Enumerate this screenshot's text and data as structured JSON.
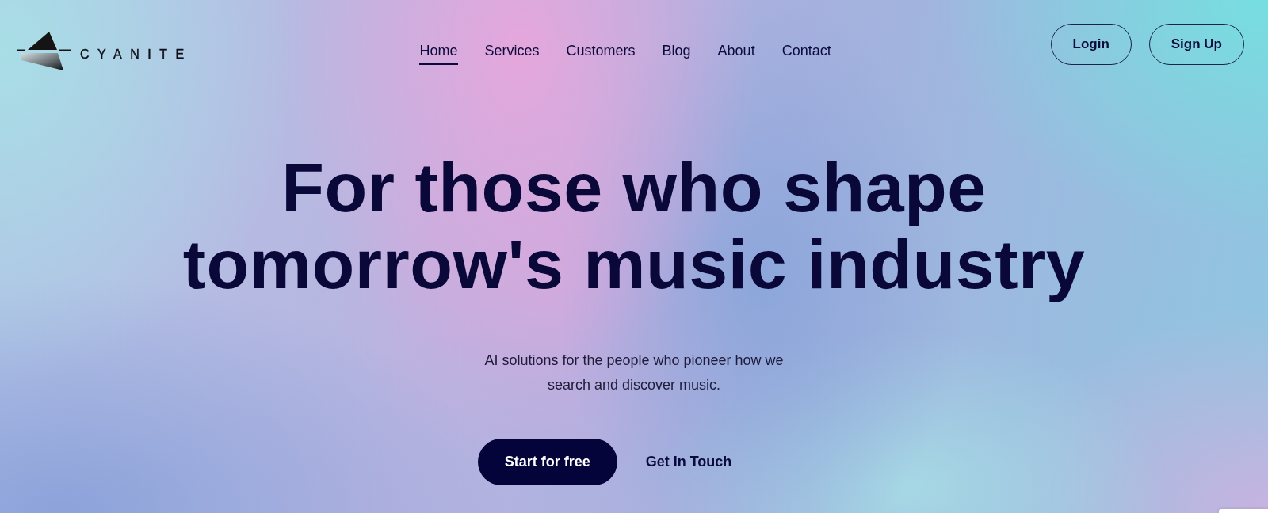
{
  "logo": {
    "wordmark": "CYANITE"
  },
  "nav": [
    {
      "label": "Home",
      "selected": true
    },
    {
      "label": "Services",
      "selected": false
    },
    {
      "label": "Customers",
      "selected": false
    },
    {
      "label": "Blog",
      "selected": false
    },
    {
      "label": "About",
      "selected": false
    },
    {
      "label": "Contact",
      "selected": false
    }
  ],
  "auth_buttons": [
    {
      "label": "Login"
    },
    {
      "label": "Sign Up"
    }
  ],
  "hero": {
    "headline": "For those who shape tomorrow's music industry",
    "subtitle": "AI solutions for the people who pioneer how we search and discover music.",
    "actions": [
      {
        "kind": "primary",
        "label": "Start for free"
      },
      {
        "kind": "link",
        "label": "Get In Touch"
      }
    ]
  }
}
